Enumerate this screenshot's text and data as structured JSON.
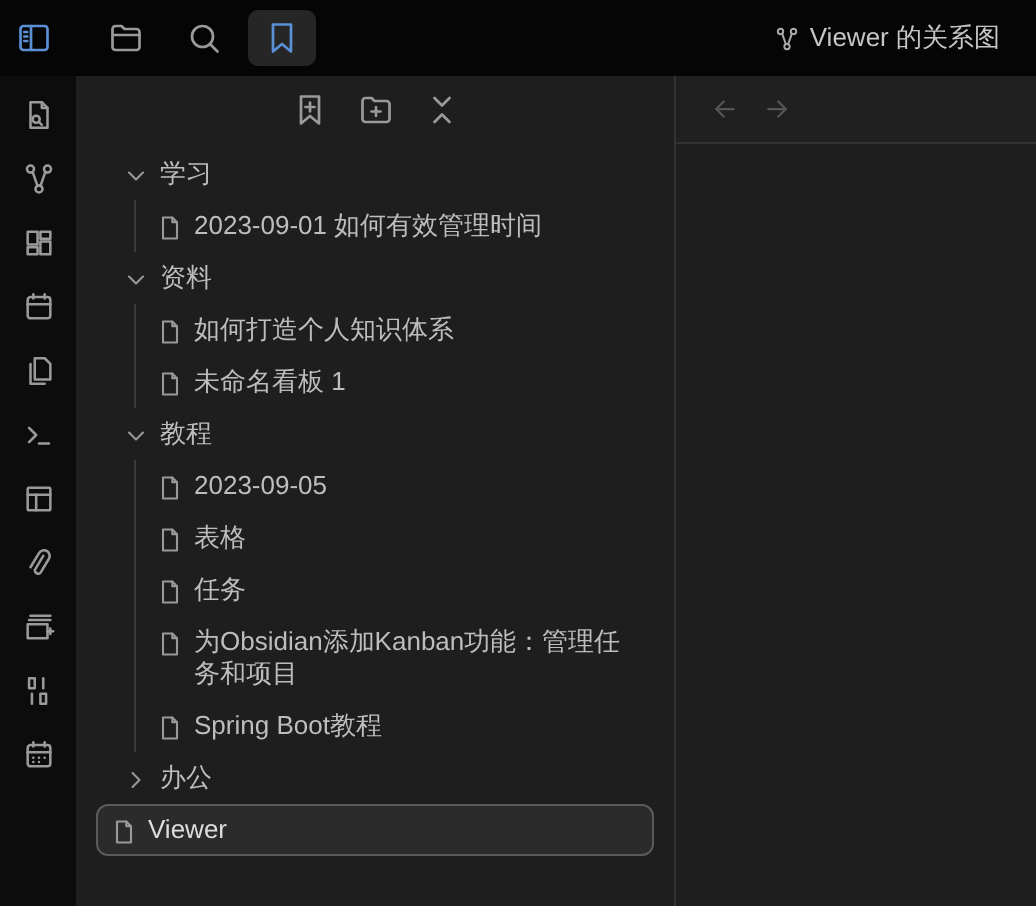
{
  "sidebar_toggle": {
    "on": true
  },
  "left_tabs": [
    {
      "kind": "files",
      "selected": false
    },
    {
      "kind": "search",
      "selected": false
    },
    {
      "kind": "bookmarks",
      "selected": true
    }
  ],
  "graph_tab": {
    "title": "Viewer 的关系图"
  },
  "bookmarks": [
    {
      "kind": "folder",
      "label": "学习",
      "expanded": true,
      "selected": false,
      "children": [
        {
          "kind": "file",
          "label": "2023-09-01 如何有效管理时间",
          "selected": false
        }
      ]
    },
    {
      "kind": "folder",
      "label": "资料",
      "expanded": true,
      "selected": false,
      "children": [
        {
          "kind": "file",
          "label": "如何打造个人知识体系",
          "selected": false
        },
        {
          "kind": "file",
          "label": "未命名看板 1",
          "selected": false
        }
      ]
    },
    {
      "kind": "folder",
      "label": "教程",
      "expanded": true,
      "selected": false,
      "children": [
        {
          "kind": "file",
          "label": "2023-09-05",
          "selected": false
        },
        {
          "kind": "file",
          "label": "表格",
          "selected": false
        },
        {
          "kind": "file",
          "label": "任务",
          "selected": false
        },
        {
          "kind": "file",
          "label": "为Obsidian添加Kanban功能：管理任务和项目",
          "selected": false
        },
        {
          "kind": "file",
          "label": "Spring Boot教程",
          "selected": false
        }
      ]
    },
    {
      "kind": "folder",
      "label": "办公",
      "expanded": false,
      "selected": false
    },
    {
      "kind": "file",
      "label": "Viewer",
      "selected": true
    }
  ]
}
